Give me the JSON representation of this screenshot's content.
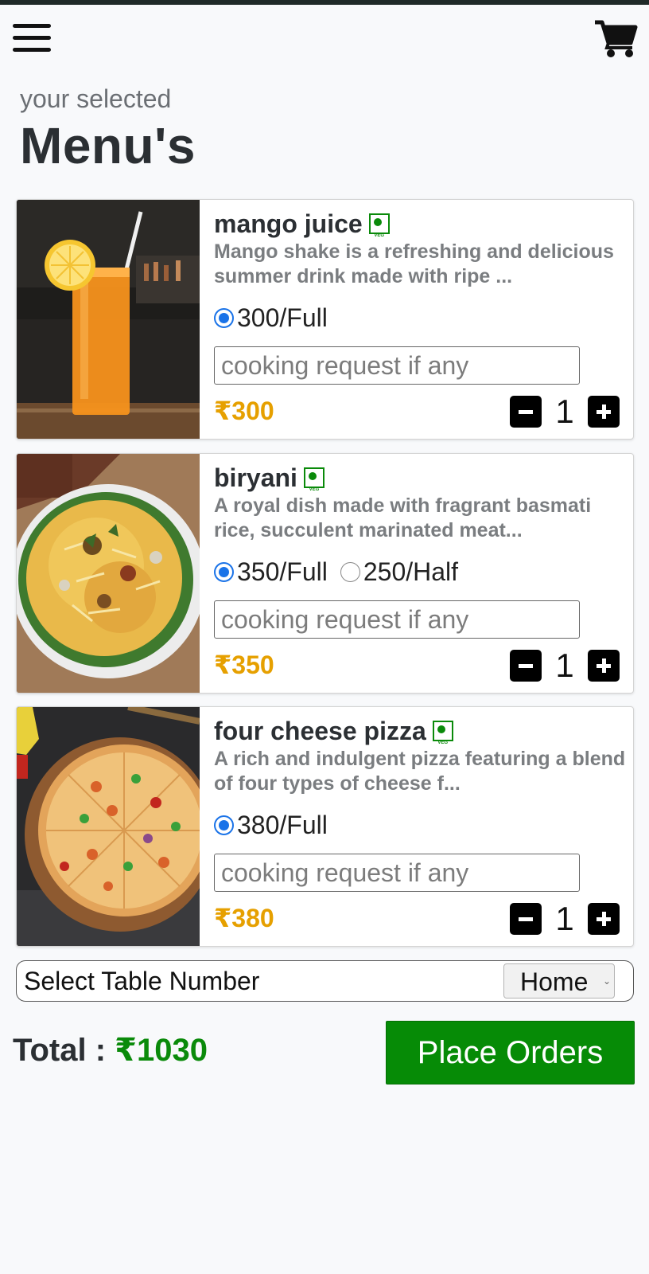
{
  "header": {
    "menu_icon": "hamburger-menu-icon",
    "cart_icon": "shopping-cart-icon"
  },
  "page": {
    "subtitle": "your selected",
    "title": "Menu's"
  },
  "colors": {
    "price": "#e6a000",
    "veg": "#0a8a0a",
    "place_button": "#068b06",
    "radio_selected": "#1a73e8"
  },
  "items": [
    {
      "name": "mango juice",
      "veg_label": "VEG",
      "description": "Mango shake is a refreshing and delicious summer drink made with ripe ...",
      "options": [
        {
          "label": "300/Full",
          "selected": true
        }
      ],
      "request_placeholder": "cooking request if any",
      "price": "₹300",
      "qty": "1",
      "image": "mango-juice-photo"
    },
    {
      "name": "biryani",
      "veg_label": "VEG",
      "description": "A royal dish made with fragrant basmati rice, succulent marinated meat...",
      "options": [
        {
          "label": "350/Full",
          "selected": true
        },
        {
          "label": "250/Half",
          "selected": false
        }
      ],
      "request_placeholder": "cooking request if any",
      "price": "₹350",
      "qty": "1",
      "image": "biryani-photo"
    },
    {
      "name": "four cheese pizza",
      "veg_label": "VEG",
      "description": "A rich and indulgent pizza featuring a blend of four types of cheese f...",
      "options": [
        {
          "label": "380/Full",
          "selected": true
        }
      ],
      "request_placeholder": "cooking request if any",
      "price": "₹380",
      "qty": "1",
      "image": "pizza-photo"
    }
  ],
  "table": {
    "label": "Select Table Number",
    "selected": "Home"
  },
  "total": {
    "label": "Total : ",
    "value": "₹1030"
  },
  "place_order_label": "Place Orders"
}
